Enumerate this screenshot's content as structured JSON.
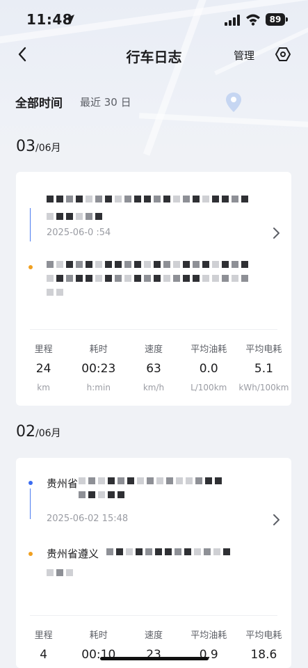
{
  "status_bar": {
    "time": "11:48",
    "battery": "89"
  },
  "nav": {
    "title": "行车日志",
    "manage": "管理"
  },
  "filter": {
    "all": "全部时间",
    "range": "最近 30 日"
  },
  "days": [
    {
      "day": "03",
      "month": "/06月",
      "trip": {
        "start_address_visible": "",
        "start_time": "2025-06-0 :54",
        "end_address_visible": "",
        "stats": [
          {
            "label": "里程",
            "value": "24",
            "unit": "km"
          },
          {
            "label": "耗时",
            "value": "00:23",
            "unit": "h:min"
          },
          {
            "label": "速度",
            "value": "63",
            "unit": "km/h"
          },
          {
            "label": "平均油耗",
            "value": "0.0",
            "unit": "L/100km"
          },
          {
            "label": "平均电耗",
            "value": "5.1",
            "unit": "kWh/100km"
          }
        ]
      }
    },
    {
      "day": "02",
      "month": "/06月",
      "trip": {
        "start_address_visible": "贵州省",
        "start_time": "2025-06-02 15:48",
        "end_address_visible": "贵州省遵义",
        "stats": [
          {
            "label": "里程",
            "value": "4"
          },
          {
            "label": "耗时",
            "value": "00:10"
          },
          {
            "label": "速度",
            "value": "23"
          },
          {
            "label": "平均油耗",
            "value": "0.9"
          },
          {
            "label": "平均电耗",
            "value": "18.6"
          }
        ]
      }
    }
  ],
  "colors": {
    "route_blue": "#3b6cf0",
    "dest_orange": "#f0a020",
    "background": "#f0f2f6"
  }
}
